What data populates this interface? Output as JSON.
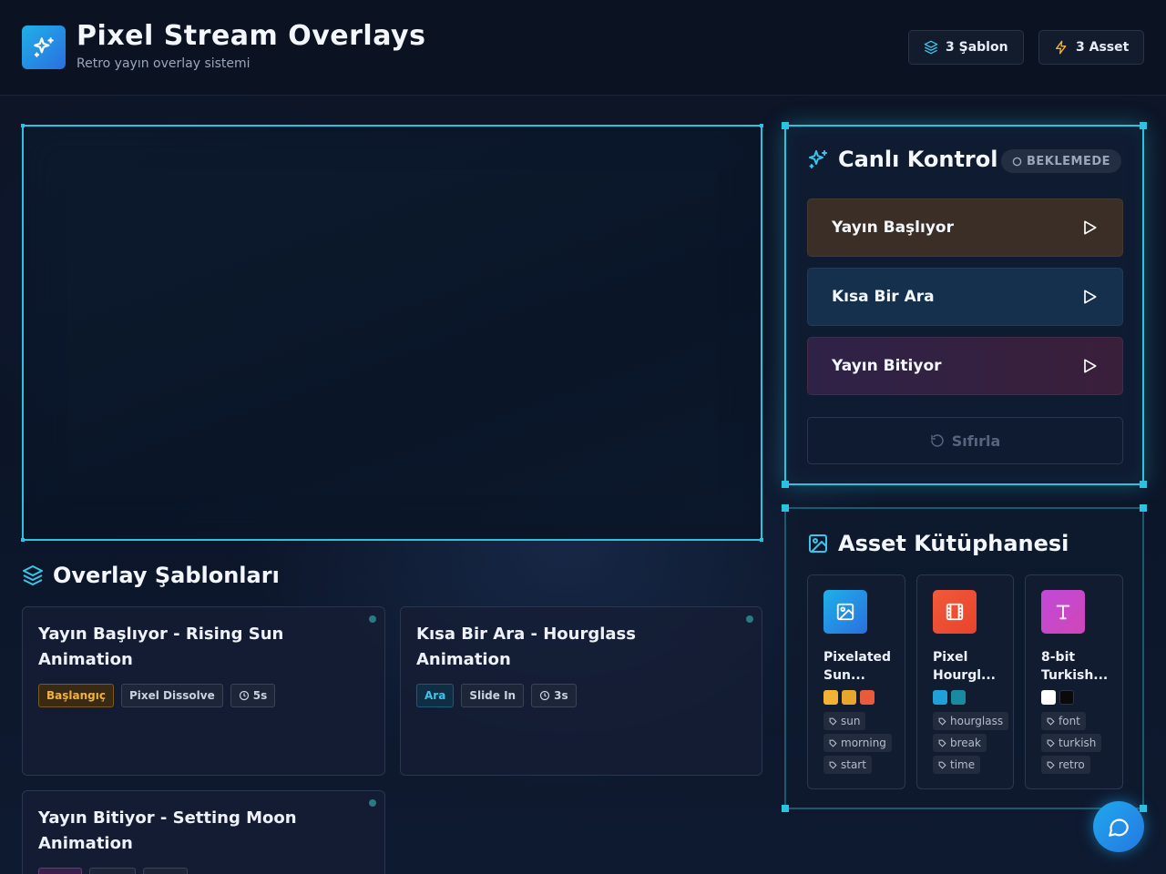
{
  "header": {
    "title": "Pixel Stream Overlays",
    "subtitle": "Retro yayın overlay sistemi",
    "templates_badge": "3 Şablon",
    "assets_badge": "3 Asset"
  },
  "templates_section": {
    "title": "Overlay Şablonları",
    "cards": [
      {
        "name": "Yayın Başlıyor - Rising Sun Animation",
        "category": "Başlangıç",
        "transition": "Pixel Dissolve",
        "duration": "5s"
      },
      {
        "name": "Kısa Bir Ara - Hourglass Animation",
        "category": "Ara",
        "transition": "Slide In",
        "duration": "3s"
      },
      {
        "name": "Yayın Bitiyor - Setting Moon Animation",
        "category": "",
        "transition": "",
        "duration": ""
      }
    ]
  },
  "live_control": {
    "title": "Canlı Kontrol",
    "status": "BEKLEMEDE",
    "triggers": [
      {
        "label": "Yayın Başlıyor",
        "color": "#3a2e26"
      },
      {
        "label": "Kısa Bir Ara",
        "color": "#15304d"
      },
      {
        "label": "Yayın Bitiyor",
        "color": "#2e2247"
      }
    ],
    "reset_label": "Sıfırla"
  },
  "asset_library": {
    "title": "Asset Kütüphanesi",
    "assets": [
      {
        "name": "Pixelated Sun...",
        "icon": "image-icon",
        "swatches": [
          "#f2b233",
          "#e8a62c",
          "#ea5a3c"
        ],
        "tags": [
          "sun",
          "morning",
          "start"
        ]
      },
      {
        "name": "Pixel Hourgl...",
        "icon": "film-icon",
        "swatches": [
          "#1fa0d8",
          "#1a8aa0"
        ],
        "tags": [
          "hourglass",
          "break",
          "time"
        ]
      },
      {
        "name": "8-bit Turkish...",
        "icon": "type-icon",
        "swatches": [
          "#ffffff",
          "#0a0a0a"
        ],
        "tags": [
          "font",
          "turkish",
          "retro"
        ]
      }
    ]
  },
  "colors": {
    "accent": "#2bc4e0",
    "brand": "#2a6fe0"
  }
}
